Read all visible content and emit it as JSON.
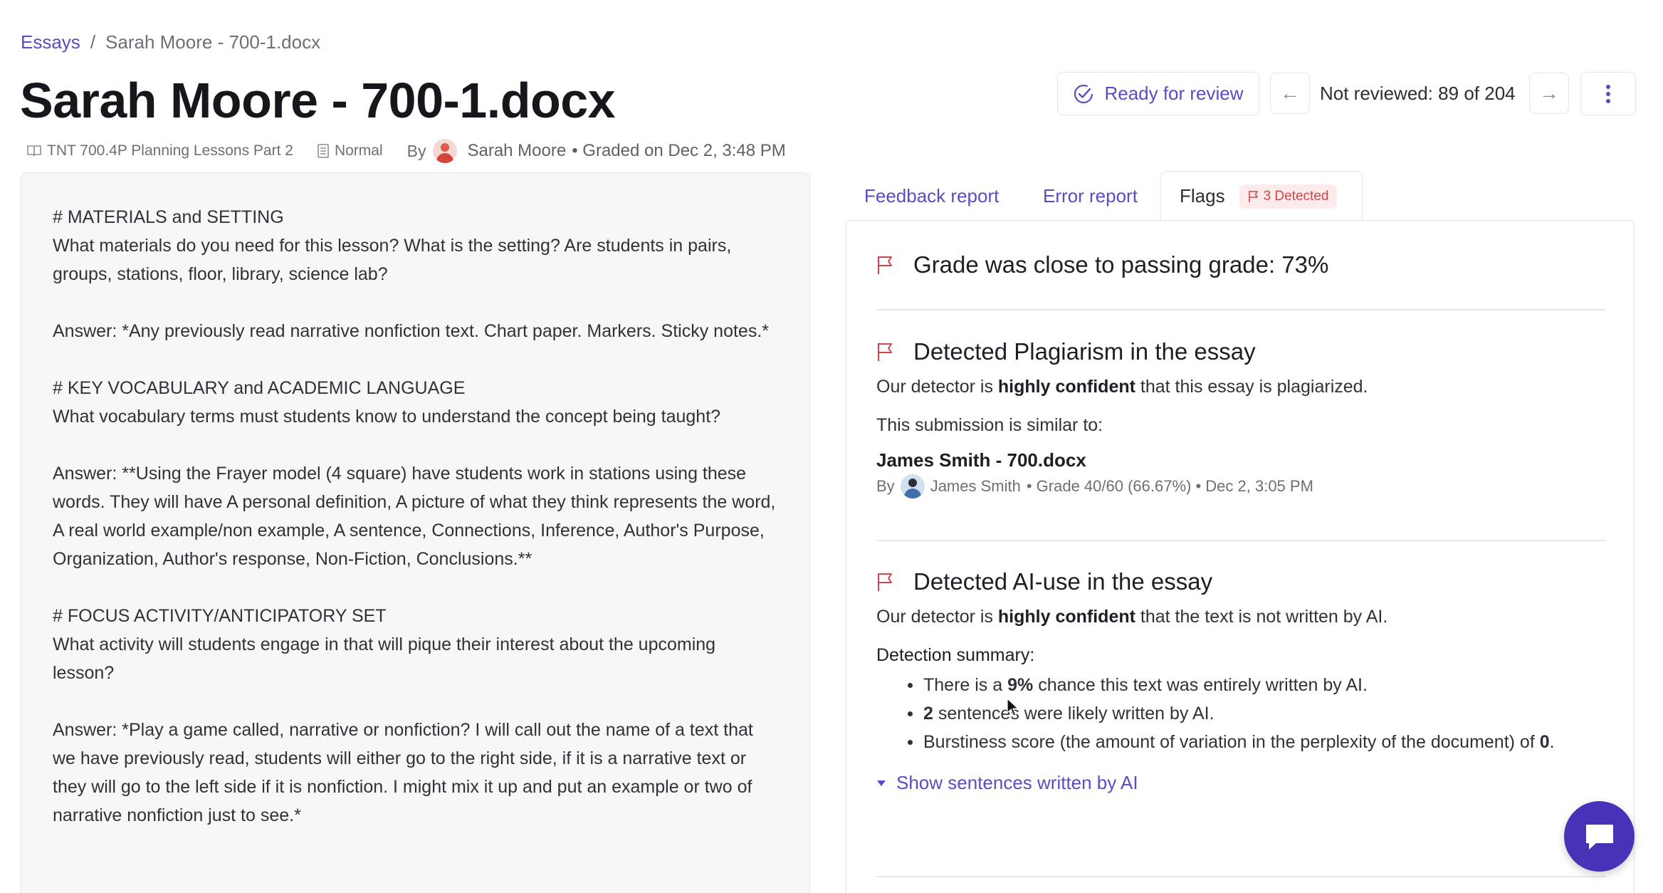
{
  "breadcrumb": {
    "link": "Essays",
    "separator": "/",
    "current": "Sarah Moore - 700-1.docx"
  },
  "title": "Sarah Moore - 700-1.docx",
  "meta": {
    "course": "TNT 700.4P Planning Lessons Part 2",
    "mode": "Normal",
    "by": "By",
    "author": "Sarah Moore",
    "graded": "• Graded on Dec 2, 3:48 PM"
  },
  "toolbar": {
    "ready_label": "Ready for review",
    "not_reviewed": "Not reviewed: 89 of 204",
    "prev_icon": "←",
    "next_icon": "→"
  },
  "essay": {
    "blocks": [
      "# MATERIALS and SETTING\nWhat materials do you need for this lesson? What is the setting? Are students in pairs, groups, stations, floor, library, science lab?",
      "Answer: *Any previously read narrative nonfiction text. Chart paper. Markers. Sticky notes.*",
      "# KEY VOCABULARY and ACADEMIC LANGUAGE\nWhat vocabulary terms must students know to understand the concept being taught?",
      "Answer: **Using the Frayer model (4 square) have students work in stations using these words. They will have A personal definition, A picture of what they think represents the word, A real world example/non example, A sentence, Connections, Inference, Author's Purpose, Organization, Author's response, Non-Fiction, Conclusions.**",
      "# FOCUS ACTIVITY/ANTICIPATORY SET\nWhat activity will students engage in that will pique their interest about the upcoming lesson?",
      "Answer: *Play a game called, narrative or nonfiction? I will call out the name of a text that we have previously read, students will either go to the right side, if it is a narrative text or they will go to the left side if it is nonfiction. I might mix it up and put an example or two of narrative nonfiction just to see.*"
    ]
  },
  "tabs": {
    "feedback": "Feedback report",
    "error": "Error report",
    "flags": "Flags",
    "flags_badge": "3 Detected"
  },
  "flags": {
    "grade": {
      "title": "Grade was close to passing grade: 73%"
    },
    "plagiarism": {
      "title": "Detected Plagiarism in the essay",
      "line_pre": "Our detector is ",
      "line_bold": "highly confident",
      "line_post": " that this essay is plagiarized.",
      "similar_label": "This submission is similar to:",
      "similar_doc": "James Smith - 700.docx",
      "similar_by": "By",
      "similar_author": "James Smith",
      "similar_detail": "• Grade 40/60 (66.67%) • Dec 2, 3:05 PM"
    },
    "ai": {
      "title": "Detected AI-use in the essay",
      "line_pre": "Our detector is ",
      "line_bold": "highly confident",
      "line_post": " that the text is not written by AI.",
      "summary_label": "Detection summary:",
      "bullet1_pre": "There is a ",
      "bullet1_bold": "9%",
      "bullet1_post": " chance this text was entirely written by AI.",
      "bullet2_bold": "2",
      "bullet2_post": " sentences were likely written by AI.",
      "bullet3_pre": "Burstiness score (the amount of variation in the perplexity of the document) of ",
      "bullet3_bold": "0",
      "bullet3_post": ".",
      "show_label": "Show sentences written by AI"
    }
  },
  "colors": {
    "accent": "#5b4bc4",
    "flag_red": "#d4444c",
    "fab": "#4a32b8"
  }
}
